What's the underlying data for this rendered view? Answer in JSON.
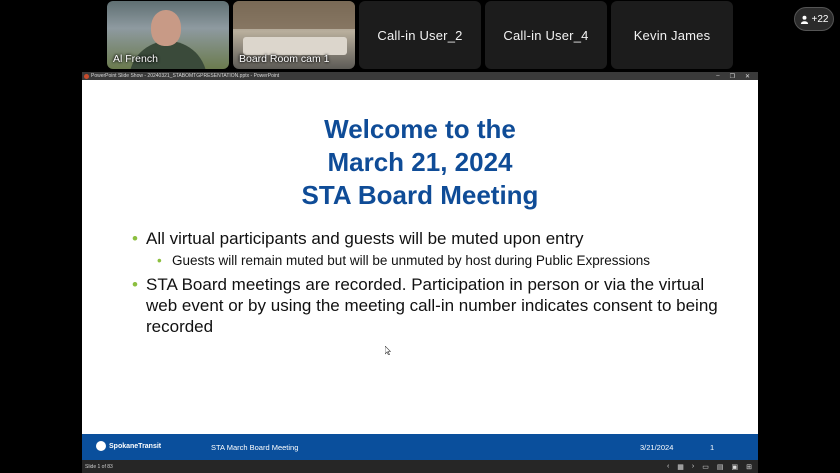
{
  "participants": [
    {
      "name": "Al French",
      "type": "video"
    },
    {
      "name": "Board Room cam 1",
      "type": "video"
    },
    {
      "name": "Call-in User_2",
      "type": "audio"
    },
    {
      "name": "Call-in User_4",
      "type": "audio"
    },
    {
      "name": "Kevin James",
      "type": "audio"
    }
  ],
  "participants_more": "+22",
  "window": {
    "title": "PowerPoint Slide Show - 20240321_STABOMTGPRESENTATION.pptx - PowerPoint"
  },
  "slide": {
    "title_line1": "Welcome to the",
    "title_line2": "March 21, 2024",
    "title_line3": "STA Board Meeting",
    "bullet1": "All virtual participants and guests will be muted upon entry",
    "bullet1_sub": "Guests will remain muted but will be unmuted by host during Public Expressions",
    "bullet2": "STA Board meetings are recorded. Participation in person or via the virtual web event or by using the meeting call-in number indicates consent to being recorded",
    "footer_logo": "SpokaneTransit",
    "footer_title": "STA March Board Meeting",
    "footer_date": "3/21/2024",
    "footer_page": "1"
  },
  "statusbar": {
    "slide_counter": "Slide 1 of 83"
  },
  "colors": {
    "title_blue": "#0f4c97",
    "footer_blue": "#0a4f9c",
    "bullet_green": "#8cbf3f"
  }
}
